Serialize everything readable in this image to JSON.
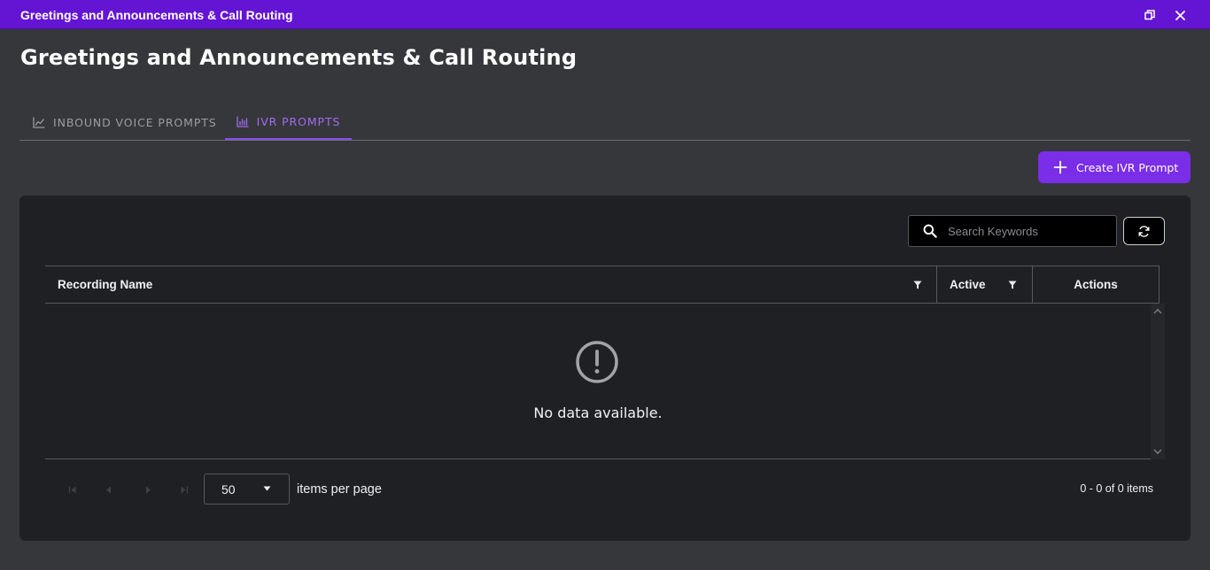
{
  "window": {
    "title": "Greetings and Announcements & Call Routing"
  },
  "page": {
    "title": "Greetings and Announcements & Call Routing"
  },
  "tabs": [
    {
      "label": "INBOUND VOICE PROMPTS",
      "icon": "line-chart-icon",
      "active": false
    },
    {
      "label": "IVR PROMPTS",
      "icon": "bar-chart-icon",
      "active": true
    }
  ],
  "toolbar": {
    "create_label": "Create IVR Prompt"
  },
  "search": {
    "placeholder": "Search Keywords",
    "value": ""
  },
  "grid": {
    "columns": [
      {
        "label": "Recording Name",
        "filterable": true
      },
      {
        "label": "Active",
        "filterable": true
      },
      {
        "label": "Actions",
        "filterable": false
      }
    ],
    "rows": [],
    "empty_message": "No data available."
  },
  "pager": {
    "page_size": "50",
    "per_page_label": "items per page",
    "items_summary": "0 - 0 of 0 items"
  },
  "colors": {
    "titlebar": "#6415d3",
    "accent": "#7a2ee8",
    "active_tab": "#a06cf0",
    "background": "#36373b",
    "panel": "#1f2023"
  }
}
